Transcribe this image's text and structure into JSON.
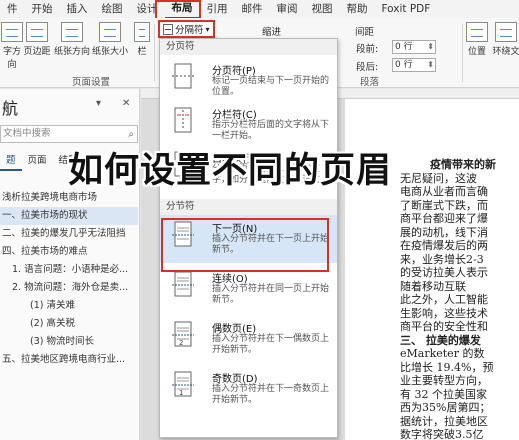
{
  "tabs": [
    "件",
    "开始",
    "插入",
    "绘图",
    "设计",
    "布局",
    "引用",
    "邮件",
    "审阅",
    "视图",
    "帮助",
    "Foxit PDF"
  ],
  "active_tab": "布局",
  "ribbon": {
    "margins": "字方向",
    "margins2": "页边距",
    "orientation": "纸张方向",
    "size": "纸张大小",
    "columns": "栏",
    "breaks": "分隔符",
    "group_page_setup": "页面设置",
    "indent_label": "缩进",
    "spacing_label": "间距",
    "spacing_before_label": "段前:",
    "spacing_after_label": "段后:",
    "spacing_before_value": "0 行",
    "spacing_after_value": "0 行",
    "paragraph_label": "段落",
    "position": "位置",
    "wrap": "环绕文"
  },
  "nav": {
    "title": "航",
    "search_placeholder": "文档中搜索",
    "tabs": [
      "题",
      "页面",
      "结果"
    ],
    "items": [
      "浅析拉美跨境电商市场",
      "一、拉美市场的现状",
      "二、拉美的爆发几乎无法阻挡",
      "四、拉美市场的难点",
      "1. 语言问题：小语种是必...",
      "2. 物流问题：海外仓是卖...",
      "(1) 清关难",
      "(2) 高关税",
      "(3) 物流时间长",
      "五、拉美地区跨境电商行业..."
    ]
  },
  "dropdown": {
    "section_page": "分页符",
    "section_section": "分节符",
    "items": [
      {
        "title": "分页符(P)",
        "desc": "标记一页结束与下一页开始的位置。"
      },
      {
        "title": "分栏符(C)",
        "desc": "指示分栏符后面的文字将从下一栏开始。"
      },
      {
        "title": "自动换行符(T)",
        "desc": "分隔网页上的对象周围的文字，如分隔题注文字与正文。"
      },
      {
        "title": "下一页(N)",
        "desc": "插入分节符并在下一页上开始新节。"
      },
      {
        "title": "连续(O)",
        "desc": "插入分节符并在同一页上开始新节。"
      },
      {
        "title": "偶数页(E)",
        "desc": "插入分节符并在下一偶数页上开始新节。"
      },
      {
        "title": "奇数页(D)",
        "desc": "插入分节符并在下一奇数页上开始新节。"
      }
    ]
  },
  "doc_lines": [
    {
      "text": "疫情带来的新",
      "bold": true
    },
    {
      "text": "无尼疑问，这波",
      "bold": false
    },
    {
      "text": "电商从业者而言确",
      "bold": false
    },
    {
      "text": "了断崖式下跌，而",
      "bold": false
    },
    {
      "text": "商平台都迎来了爆",
      "bold": false
    },
    {
      "text": "展的动机，线下消",
      "bold": false
    },
    {
      "text": "在疫情爆发后的两",
      "bold": false
    },
    {
      "text": "来，业务增长2-3",
      "bold": false
    },
    {
      "text": "的受访拉美人表示",
      "bold": false
    },
    {
      "text": "随着移动互联",
      "bold": false
    },
    {
      "text": "此之外，人工智能",
      "bold": false
    },
    {
      "text": "生影响，这些技术",
      "bold": false
    },
    {
      "text": "商平台的安全性和",
      "bold": false
    },
    {
      "text": "三、  拉美的爆发",
      "bold": true
    },
    {
      "text": "eMarketer 的数",
      "bold": false
    },
    {
      "text": "比增长 19.4%，预",
      "bold": false
    },
    {
      "text": "业主要转型方向，",
      "bold": false
    },
    {
      "text": "有 32 个拉美国家",
      "bold": false
    },
    {
      "text": "西为35%居第四；",
      "bold": false
    },
    {
      "text": "据统计，拉美地区",
      "bold": false
    },
    {
      "text": "数字将突破3.5亿",
      "bold": false
    }
  ],
  "banner": "如何设置不同的页眉"
}
